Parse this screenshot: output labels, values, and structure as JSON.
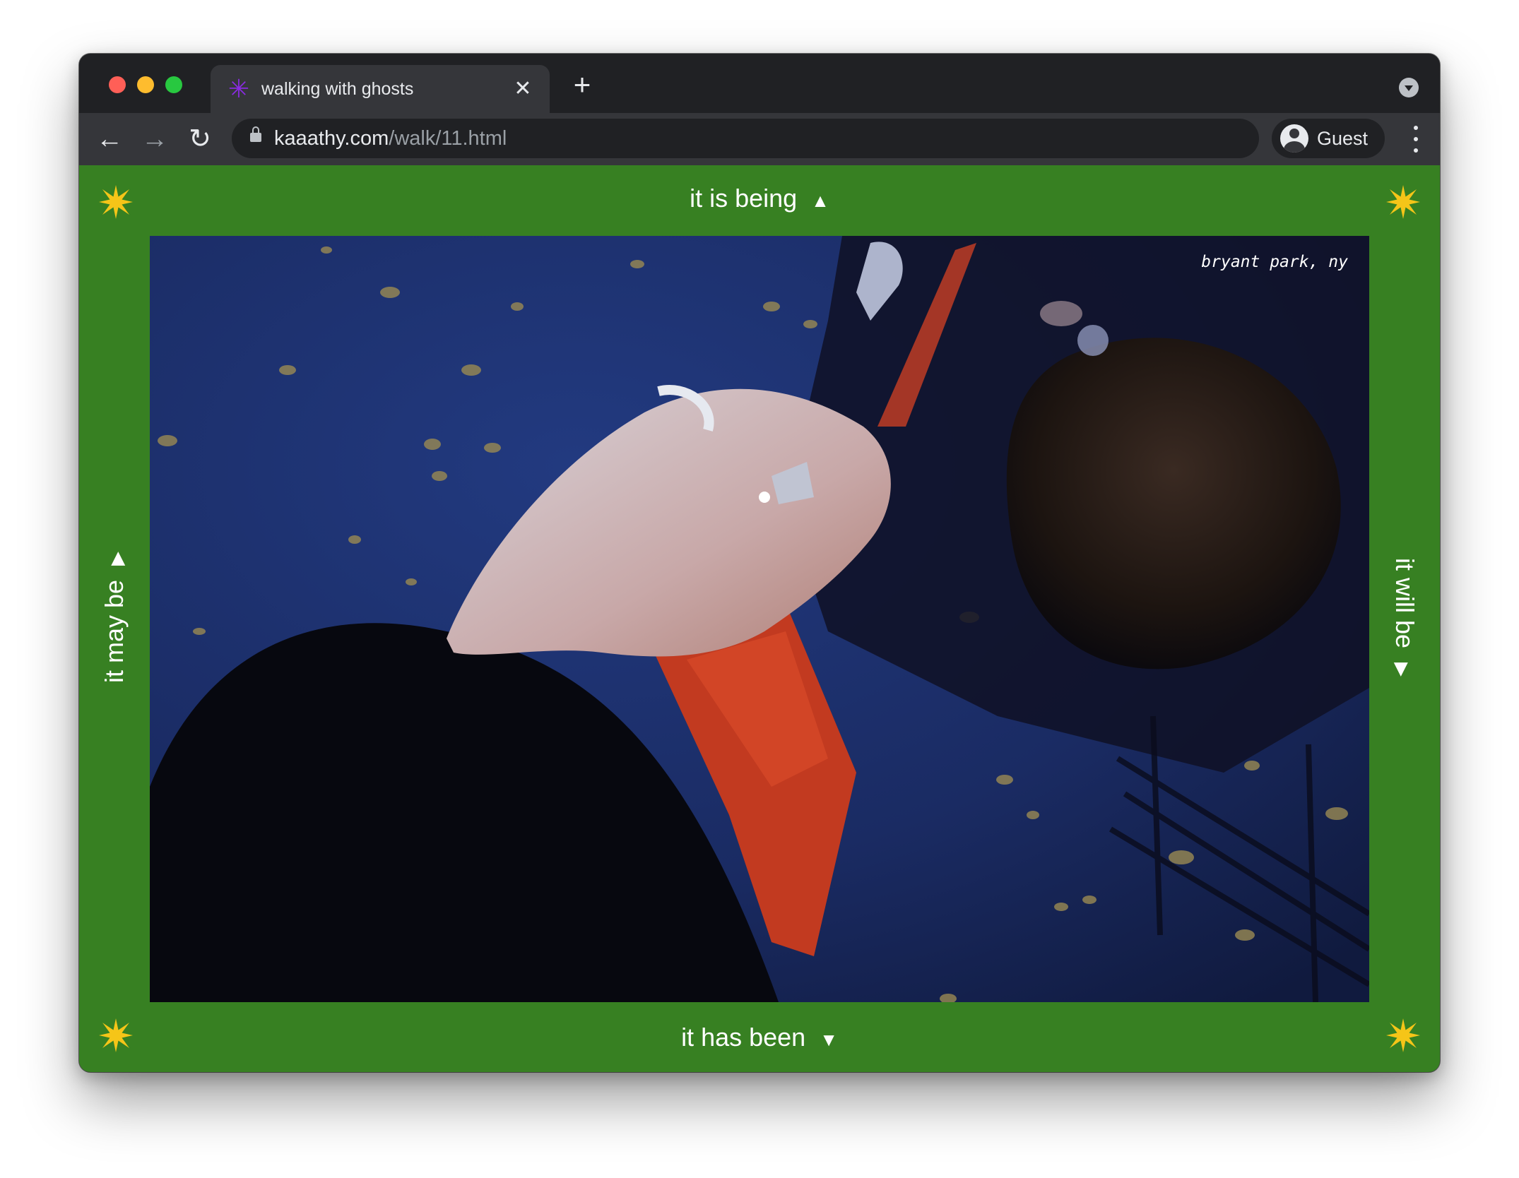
{
  "browser": {
    "tab_title": "walking with ghosts",
    "url_host": "kaaathy.com",
    "url_path": "/walk/11.html",
    "profile_label": "Guest",
    "favicon_color": "#8a2be2"
  },
  "page": {
    "background_color": "#378022",
    "star_color": "#f5c518",
    "nav": {
      "up": {
        "label": "it is being",
        "arrow": "▲"
      },
      "down": {
        "label": "it has been",
        "arrow": "▼"
      },
      "left": {
        "label": "it may be",
        "arrow": "▶"
      },
      "right": {
        "label": "it will be",
        "arrow": "▶"
      }
    },
    "photo": {
      "caption": "bryant park, ny"
    }
  }
}
